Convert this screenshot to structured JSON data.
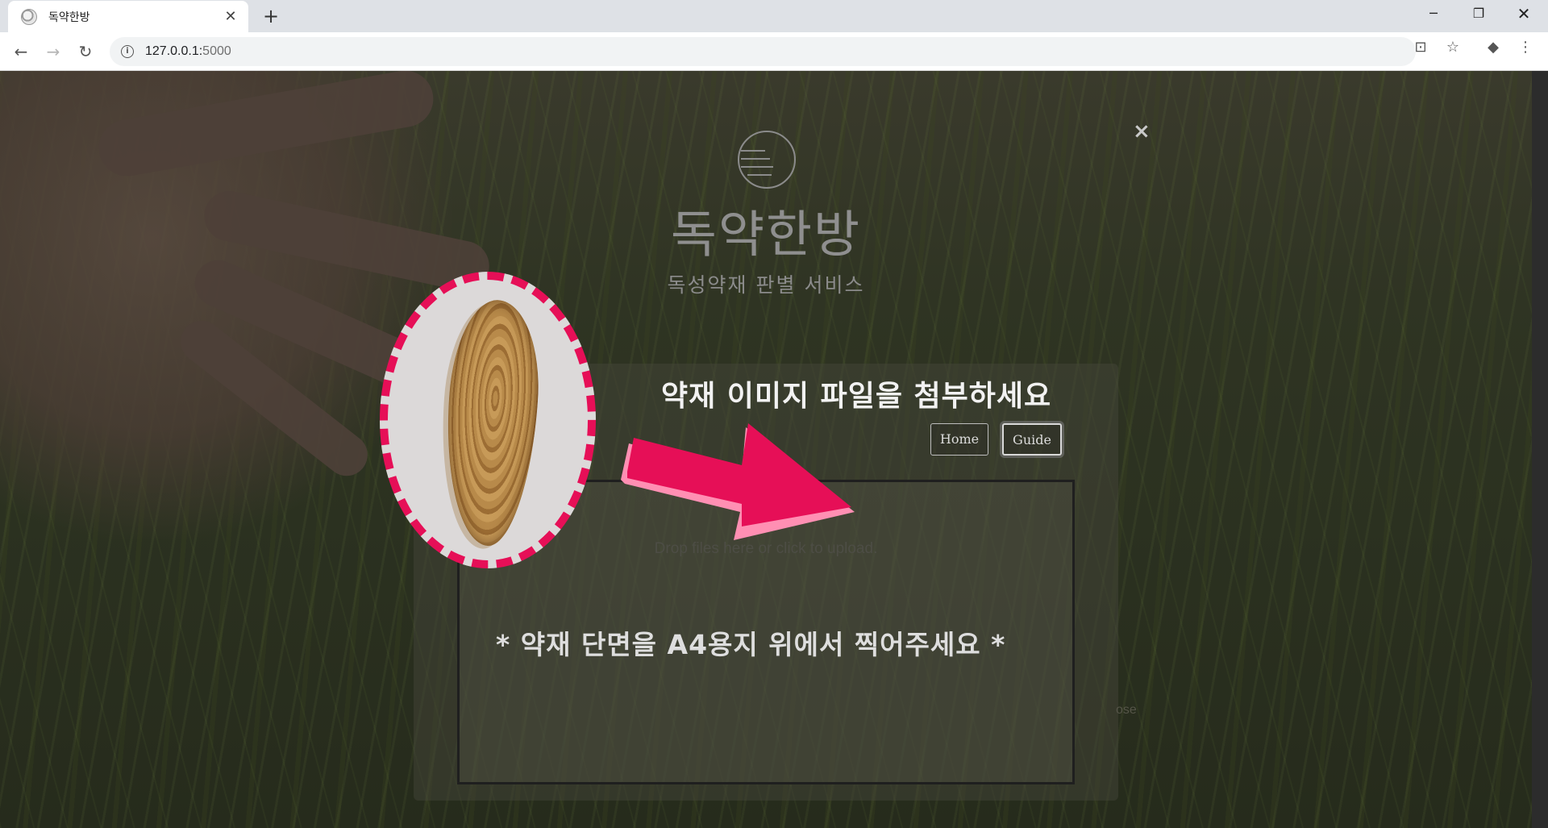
{
  "browser": {
    "tab_title": "독약한방",
    "url_host": "127.0.0.1:",
    "url_port": "5000"
  },
  "modal": {
    "close_label": "×",
    "brand_name": "독약한방",
    "subtitle": "독성약재 판별 서비스",
    "upload_title": "약재 이미지 파일을 첨부하세요",
    "home_button": "Home",
    "guide_button": "Guide",
    "dropzone_text": "Drop files here or click to upload.",
    "hint_text": "* 약재 단면을 A4용지 위에서 찍어주세요 *",
    "background_close_label": "ose"
  },
  "colors": {
    "annotation_accent": "#e60f57",
    "arrow_highlight": "#ff8fb3"
  },
  "icons": [
    "favicon-icon",
    "tab-close-icon",
    "new-tab-icon",
    "minimize-icon",
    "restore-icon",
    "window-close-icon",
    "back-icon",
    "forward-icon",
    "reload-icon",
    "site-info-icon",
    "translate-icon",
    "bookmark-star-icon",
    "extension-icon",
    "menu-icon",
    "modal-close-icon",
    "logo-icon",
    "arrow-icon"
  ]
}
